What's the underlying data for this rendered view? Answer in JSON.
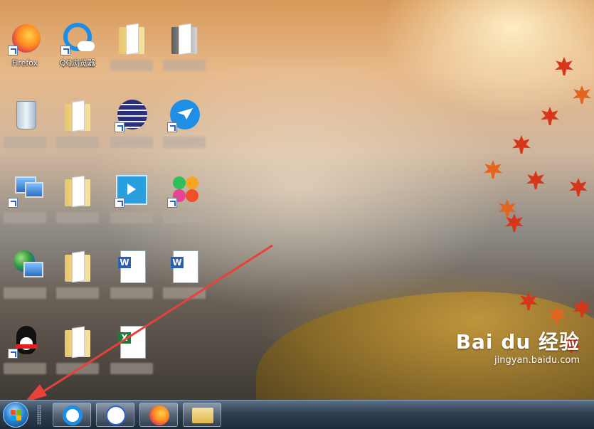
{
  "desktop": {
    "icons": [
      {
        "name": "firefox",
        "label": "Firefox"
      },
      {
        "name": "qq-browser",
        "label": "QQ浏览器"
      }
    ]
  },
  "taskbar": {
    "pinned": [
      "qq-browser-icon",
      "baidu-icon",
      "firefox-icon",
      "file-explorer-icon"
    ]
  },
  "watermark": {
    "logo": "Bai du 经验",
    "url": "jingyan.baidu.com"
  },
  "colors": {
    "arrow": "#e8413a",
    "taskbar": "#2f3f52",
    "start_orb": "#2e87d6"
  }
}
